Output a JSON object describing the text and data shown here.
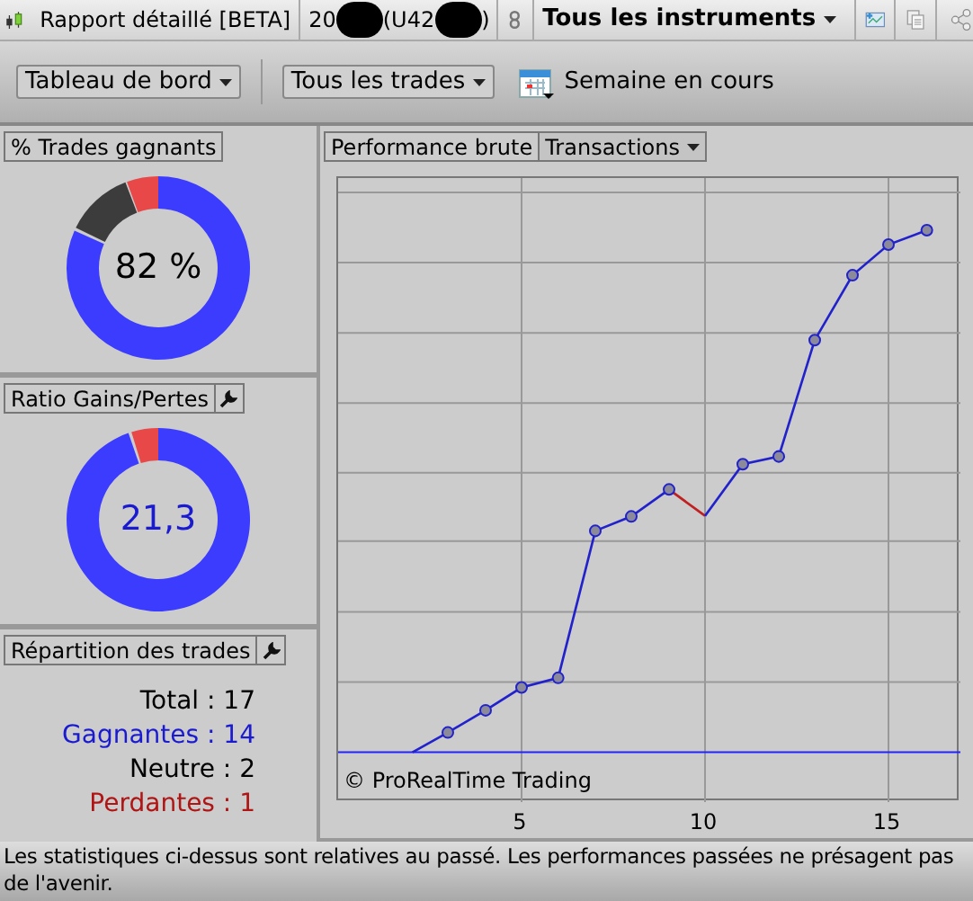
{
  "top_bar": {
    "title": "Rapport détaillé [BETA]",
    "account_parts": [
      "20",
      "(U42",
      ")"
    ],
    "instrument_menu": "Tous les instruments"
  },
  "toolbar": {
    "view_menu": "Tableau de bord",
    "trades_menu": "Tous les trades",
    "period": "Semaine en cours"
  },
  "panels": [
    {
      "title": "% Trades gagnants",
      "has_settings": false,
      "value": "82 %",
      "kind": "win-rate"
    },
    {
      "title": "Ratio Gains/Pertes",
      "has_settings": true,
      "value": "21,3",
      "kind": "ratio"
    }
  ],
  "breakdown": {
    "title": "Répartition des trades",
    "has_settings": true,
    "lines": [
      {
        "text": "Total : 17",
        "color": "#000000"
      },
      {
        "text": "Gagnantes : 14",
        "color": "#1a1ad0"
      },
      {
        "text": "Neutre : 2",
        "color": "#000000"
      },
      {
        "text": "Perdantes : 1",
        "color": "#b01515"
      }
    ]
  },
  "chart_panel": {
    "tab": "Performance brute",
    "menu": "Transactions",
    "watermark": "© ProRealTime Trading",
    "x_tick_labels": [
      "5",
      "10",
      "15"
    ]
  },
  "footer": "Les statistiques ci-dessus sont relatives au passé. Les performances passées ne présagent pas de l'avenir."
}
